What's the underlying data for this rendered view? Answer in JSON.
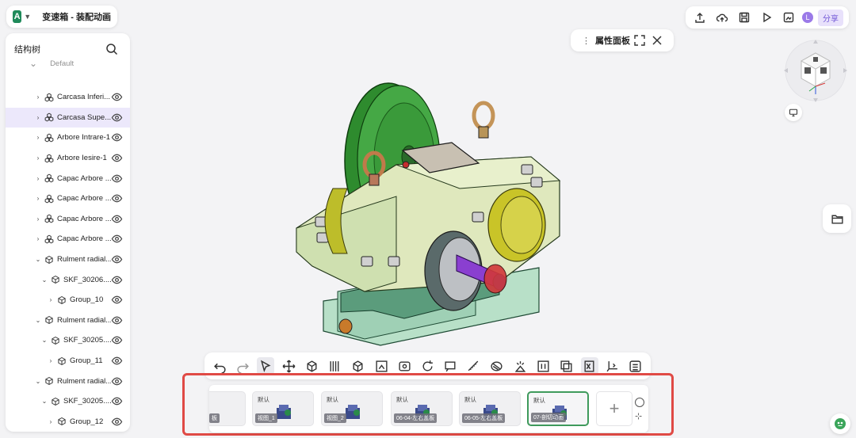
{
  "app": {
    "logo_letter": "A",
    "title": "变速箱 - 装配动画"
  },
  "tree": {
    "header": "结构树",
    "partial_row": "Default",
    "rows": [
      {
        "label": "Carcasa Inferi...",
        "level": 1,
        "type": "assembly",
        "expanded": false,
        "selected": false
      },
      {
        "label": "Carcasa Supe...",
        "level": 1,
        "type": "assembly",
        "expanded": false,
        "selected": true
      },
      {
        "label": "Arbore Intrare-1",
        "level": 1,
        "type": "assembly",
        "expanded": false,
        "selected": false
      },
      {
        "label": "Arbore Iesire-1",
        "level": 1,
        "type": "assembly",
        "expanded": false,
        "selected": false
      },
      {
        "label": "Capac Arbore ...",
        "level": 1,
        "type": "assembly",
        "expanded": false,
        "selected": false
      },
      {
        "label": "Capac Arbore ...",
        "level": 1,
        "type": "assembly",
        "expanded": false,
        "selected": false
      },
      {
        "label": "Capac Arbore ...",
        "level": 1,
        "type": "assembly",
        "expanded": false,
        "selected": false
      },
      {
        "label": "Capac Arbore ...",
        "level": 1,
        "type": "assembly",
        "expanded": false,
        "selected": false
      },
      {
        "label": "Rulment radial...",
        "level": 1,
        "type": "part",
        "expanded": true,
        "selected": false
      },
      {
        "label": "SKF_30206....",
        "level": 2,
        "type": "part",
        "expanded": true,
        "selected": false
      },
      {
        "label": "Group_10",
        "level": 3,
        "type": "part",
        "expanded": false,
        "selected": false
      },
      {
        "label": "Rulment radial...",
        "level": 1,
        "type": "part",
        "expanded": true,
        "selected": false
      },
      {
        "label": "SKF_30205....",
        "level": 2,
        "type": "part",
        "expanded": true,
        "selected": false
      },
      {
        "label": "Group_11",
        "level": 3,
        "type": "part",
        "expanded": false,
        "selected": false
      },
      {
        "label": "Rulment radial...",
        "level": 1,
        "type": "part",
        "expanded": true,
        "selected": false
      },
      {
        "label": "SKF_30205....",
        "level": 2,
        "type": "part",
        "expanded": true,
        "selected": false
      },
      {
        "label": "Group_12",
        "level": 3,
        "type": "part",
        "expanded": false,
        "selected": false
      }
    ]
  },
  "property_panel": {
    "title": "属性面板"
  },
  "top_right": {
    "avatar_letter": "L",
    "share_label": "分享"
  },
  "animation": {
    "frames": [
      {
        "tag": "",
        "caption": "板",
        "active": false,
        "partial": true
      },
      {
        "tag": "默认",
        "caption": "视图_1",
        "active": false,
        "partial": false
      },
      {
        "tag": "默认",
        "caption": "视图_2",
        "active": false,
        "partial": false
      },
      {
        "tag": "默认",
        "caption": "06-04-左右盖板",
        "active": false,
        "partial": false
      },
      {
        "tag": "默认",
        "caption": "06-05-左右盖板",
        "active": false,
        "partial": false
      },
      {
        "tag": "默认",
        "caption": "07-剖切动画",
        "active": true,
        "partial": false
      }
    ],
    "add_label": "+"
  },
  "colors": {
    "accent": "#7157d6",
    "selected_row": "#ece8fb",
    "highlight_border": "#e04a45",
    "active_frame": "#3f9a5c",
    "gear_green": "#3a9a3a",
    "housing": "#d8e6bf"
  }
}
